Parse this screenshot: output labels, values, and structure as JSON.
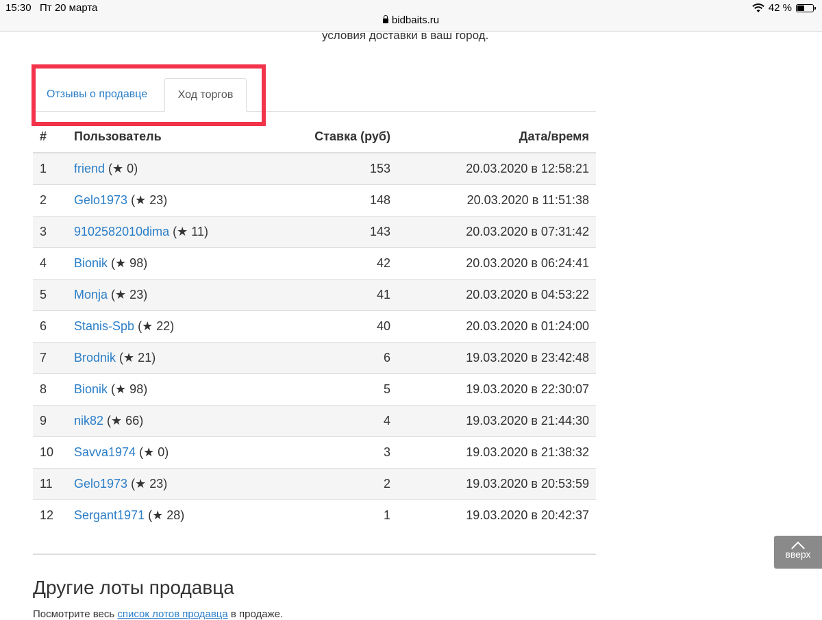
{
  "status_bar": {
    "time": "15:30",
    "date": "Пт 20 марта",
    "battery": "42 %",
    "url": "bidbaits.ru"
  },
  "delivery_text": "условия доставки в ваш город.",
  "tabs": [
    {
      "label": "Отзывы о продавце",
      "active": false
    },
    {
      "label": "Ход торгов",
      "active": true
    }
  ],
  "table": {
    "headers": {
      "num": "#",
      "user": "Пользователь",
      "bid": "Ставка (руб)",
      "date": "Дата/время"
    },
    "rows": [
      {
        "num": "1",
        "user": "friend",
        "rating": "(★ 0)",
        "bid": "153",
        "date": "20.03.2020 в 12:58:21"
      },
      {
        "num": "2",
        "user": "Gelo1973",
        "rating": "(★ 23)",
        "bid": "148",
        "date": "20.03.2020 в 11:51:38"
      },
      {
        "num": "3",
        "user": "9102582010dima",
        "rating": "(★ 11)",
        "bid": "143",
        "date": "20.03.2020 в 07:31:42"
      },
      {
        "num": "4",
        "user": "Bionik",
        "rating": "(★ 98)",
        "bid": "42",
        "date": "20.03.2020 в 06:24:41"
      },
      {
        "num": "5",
        "user": "Monja",
        "rating": "(★ 23)",
        "bid": "41",
        "date": "20.03.2020 в 04:53:22"
      },
      {
        "num": "6",
        "user": "Stanis-Spb",
        "rating": "(★ 22)",
        "bid": "40",
        "date": "20.03.2020 в 01:24:00"
      },
      {
        "num": "7",
        "user": "Brodnik",
        "rating": "(★ 21)",
        "bid": "6",
        "date": "19.03.2020 в 23:42:48"
      },
      {
        "num": "8",
        "user": "Bionik",
        "rating": "(★ 98)",
        "bid": "5",
        "date": "19.03.2020 в 22:30:07"
      },
      {
        "num": "9",
        "user": "nik82",
        "rating": "(★ 66)",
        "bid": "4",
        "date": "19.03.2020 в 21:44:30"
      },
      {
        "num": "10",
        "user": "Savva1974",
        "rating": "(★ 0)",
        "bid": "3",
        "date": "19.03.2020 в 21:38:32"
      },
      {
        "num": "11",
        "user": "Gelo1973",
        "rating": "(★ 23)",
        "bid": "2",
        "date": "19.03.2020 в 20:53:59"
      },
      {
        "num": "12",
        "user": "Sergant1971",
        "rating": "(★ 28)",
        "bid": "1",
        "date": "19.03.2020 в 20:42:37"
      }
    ]
  },
  "other_lots": {
    "title": "Другие лоты продавца",
    "text_before": "Посмотрите весь ",
    "link": "список лотов продавца",
    "text_after": " в продаже."
  },
  "scroll_top": {
    "label": "вверх"
  },
  "colors": {
    "link": "#2a7ec8",
    "highlight": "#f2334b",
    "stripe": "#f5f5f5"
  }
}
